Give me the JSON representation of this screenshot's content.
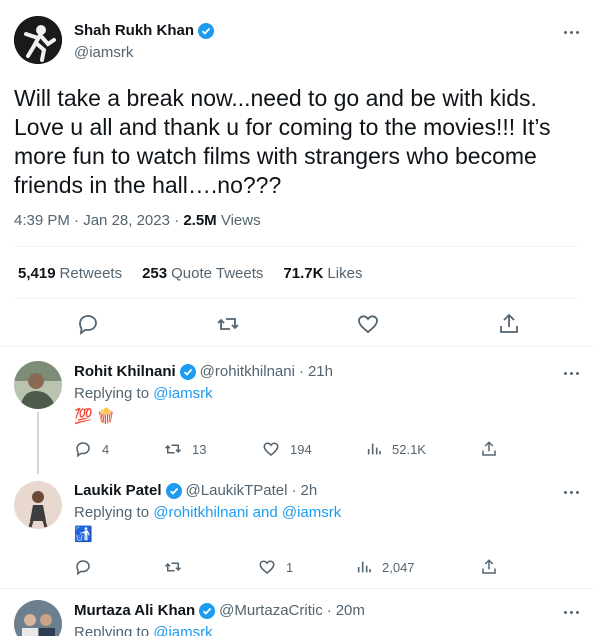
{
  "main_tweet": {
    "author_name": "Shah Rukh Khan",
    "author_handle": "@iamsrk",
    "text": "Will take a break now...need to go and be with kids. Love u all and thank u for coming to the movies!!! It’s more fun to watch films with strangers who become friends in the hall….no???",
    "time": "4:39 PM",
    "date": "Jan 28, 2023",
    "views_count": "2.5M",
    "views_label": "Views",
    "retweets_count": "5,419",
    "retweets_label": "Retweets",
    "quotes_count": "253",
    "quotes_label": "Quote Tweets",
    "likes_count": "71.7K",
    "likes_label": "Likes"
  },
  "replies": [
    {
      "name": "Rohit Khilnani",
      "handle": "@rohitkhilnani",
      "age": "21h",
      "replying_prefix": "Replying to",
      "replying_to": "@iamsrk",
      "body_emoji": "💯 🍿",
      "replies": "4",
      "retweets": "13",
      "likes": "194",
      "views": "52.1K"
    },
    {
      "name": "Laukik Patel",
      "handle": "@LaukikTPatel",
      "age": "2h",
      "replying_prefix": "Replying to",
      "replying_to": "@rohitkhilnani and @iamsrk",
      "body_emoji": "🚮",
      "replies": "",
      "retweets": "",
      "likes": "1",
      "views": "2,047"
    },
    {
      "name": "Murtaza Ali Khan",
      "handle": "@MurtazaCritic",
      "age": "20m",
      "replying_prefix": "Replying to",
      "replying_to": "@iamsrk"
    }
  ],
  "colors": {
    "accent": "#1d9bf0",
    "text": "#0f1419",
    "muted": "#536471",
    "border": "#eff3f4"
  },
  "icons": [
    "verified-badge-icon",
    "more-icon",
    "reply-icon",
    "retweet-icon",
    "like-icon",
    "share-icon",
    "views-icon"
  ]
}
